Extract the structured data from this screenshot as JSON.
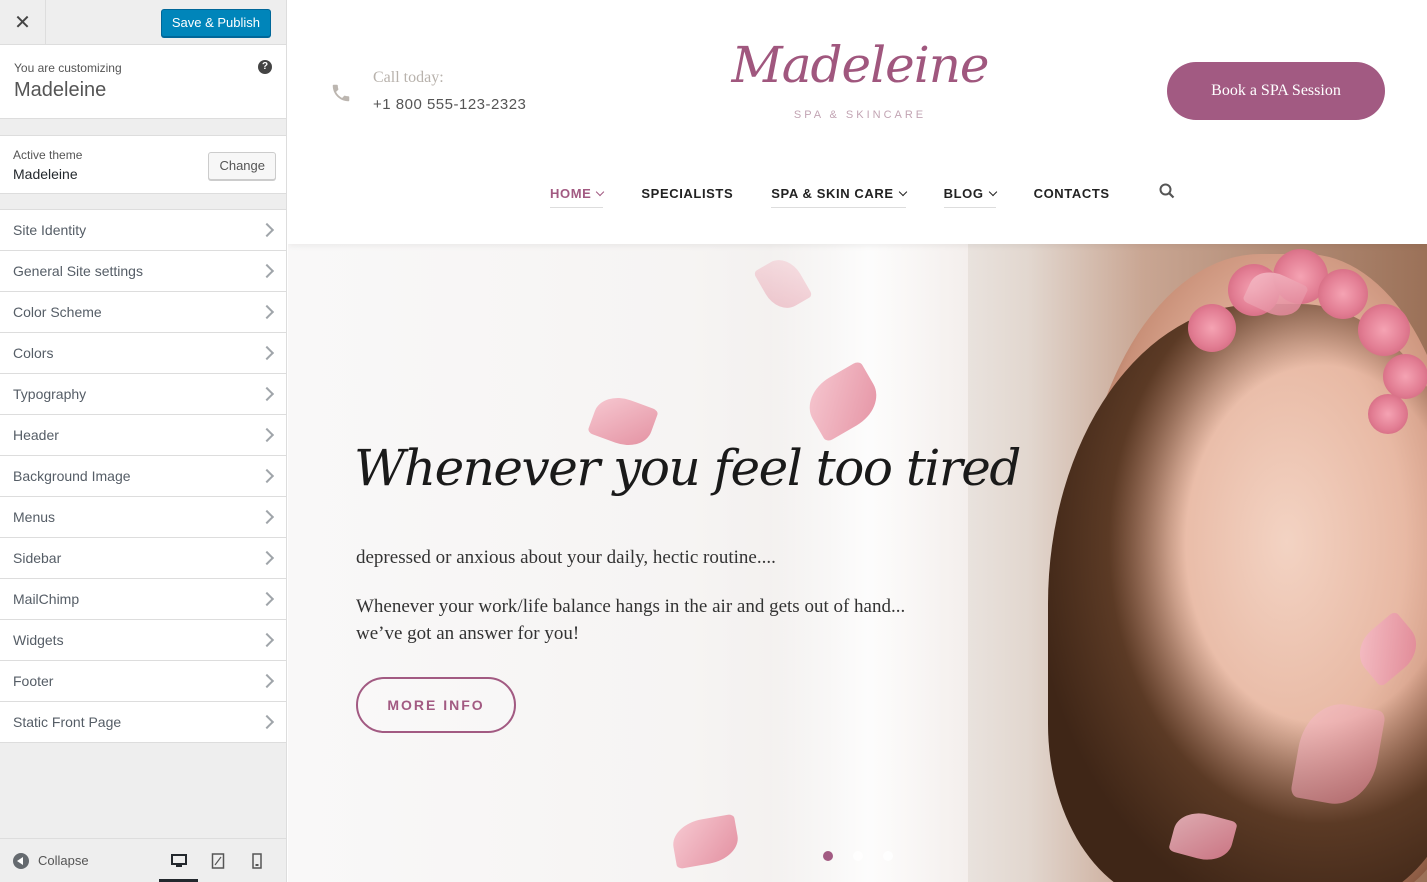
{
  "customizer": {
    "close_icon": "close-icon",
    "save_label": "Save & Publish",
    "info_small": "You are customizing",
    "info_site": "Madeleine",
    "theme_small": "Active theme",
    "theme_name": "Madeleine",
    "change_label": "Change",
    "sections": [
      {
        "label": "Site Identity"
      },
      {
        "label": "General Site settings"
      },
      {
        "label": "Color Scheme"
      },
      {
        "label": "Colors"
      },
      {
        "label": "Typography"
      },
      {
        "label": "Header"
      },
      {
        "label": "Background Image"
      },
      {
        "label": "Menus"
      },
      {
        "label": "Sidebar"
      },
      {
        "label": "MailChimp"
      },
      {
        "label": "Widgets"
      },
      {
        "label": "Footer"
      },
      {
        "label": "Static Front Page"
      }
    ],
    "collapse_label": "Collapse",
    "active_device": "desktop",
    "accent": "#0085ba"
  },
  "site": {
    "call_today": "Call today:",
    "phone": "+1 800 555-123-2323",
    "logo_script": "Madeleine",
    "logo_tagline": "SPA & SKINCARE",
    "book_label": "Book a SPA Session",
    "nav": [
      {
        "label": "HOME"
      },
      {
        "label": "SPECIALISTS"
      },
      {
        "label": "SPA & SKIN CARE"
      },
      {
        "label": "BLOG"
      },
      {
        "label": "CONTACTS"
      }
    ],
    "hero": {
      "title": "Whenever you feel too tired",
      "line1": "depressed or anxious about your daily, hectic routine....",
      "line2": "Whenever your work/life balance hangs in the air and gets out of hand...",
      "line3": "we’ve got an answer for you!",
      "button": "MORE INFO",
      "active_slide": 1,
      "slides": 3
    },
    "brand_color": "#a25a82"
  }
}
